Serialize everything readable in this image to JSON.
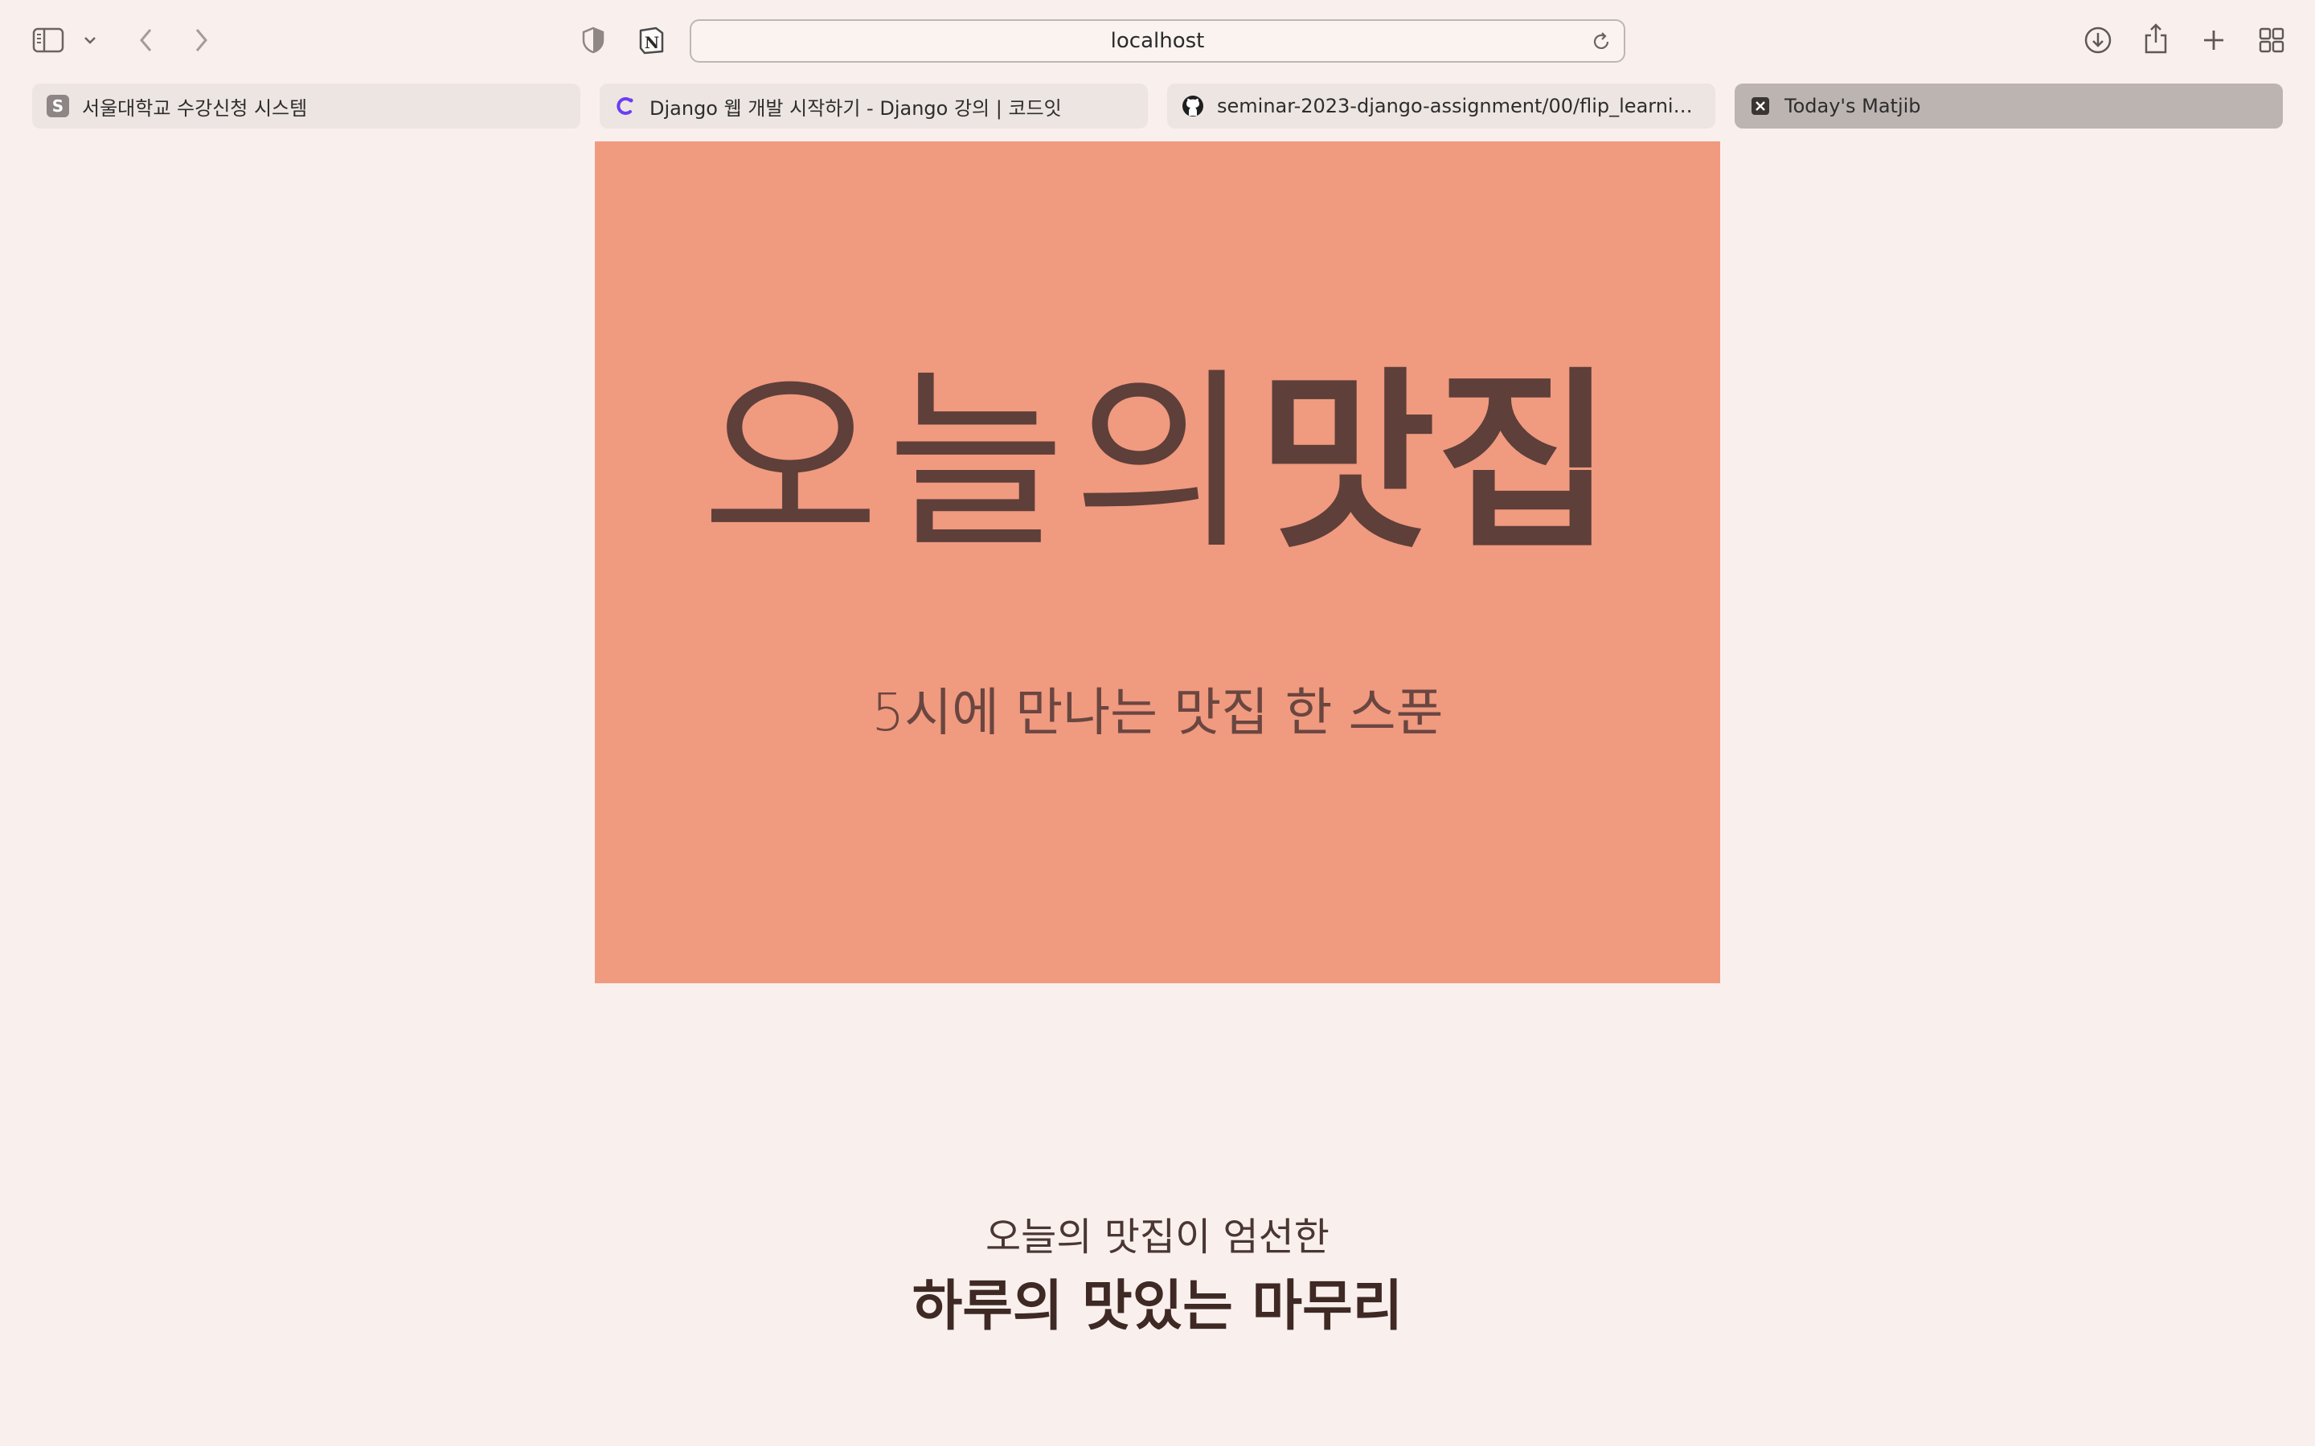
{
  "browser": {
    "url": "localhost",
    "tabs": [
      {
        "title": "서울대학교 수강신청 시스템",
        "favicon_letter": "S",
        "active": false
      },
      {
        "title": "Django 웹 개발 시작하기 - Django 강의 | 코드잇",
        "favicon_letter": "",
        "active": false
      },
      {
        "title": "seminar-2023-django-assignment/00/flip_learning...",
        "favicon_letter": "",
        "active": false
      },
      {
        "title": "Today's Matjib",
        "favicon_letter": "",
        "active": true
      }
    ],
    "icons": {
      "sidebar": "sidebar-icon",
      "back": "chevron-left-icon",
      "forward": "chevron-right-icon",
      "privacy": "shield-icon",
      "notion": "notion-icon",
      "reload": "reload-icon",
      "download": "download-icon",
      "share": "share-icon",
      "new_tab": "plus-icon",
      "tab_overview": "grid-icon"
    }
  },
  "hero": {
    "title_light": "오늘의",
    "title_bold": "맛집",
    "subtitle": "5시에 만나는 맛집 한 스푼"
  },
  "section": {
    "kicker": "오늘의 맛집이 엄선한",
    "heading": "하루의 맛있는 마무리"
  },
  "colors": {
    "page_background": "#f9f0ed",
    "hero_background": "#f09a80",
    "hero_text": "#5e3f39",
    "active_tab": "#bcb4b1",
    "inactive_tab": "#ede5e2"
  }
}
